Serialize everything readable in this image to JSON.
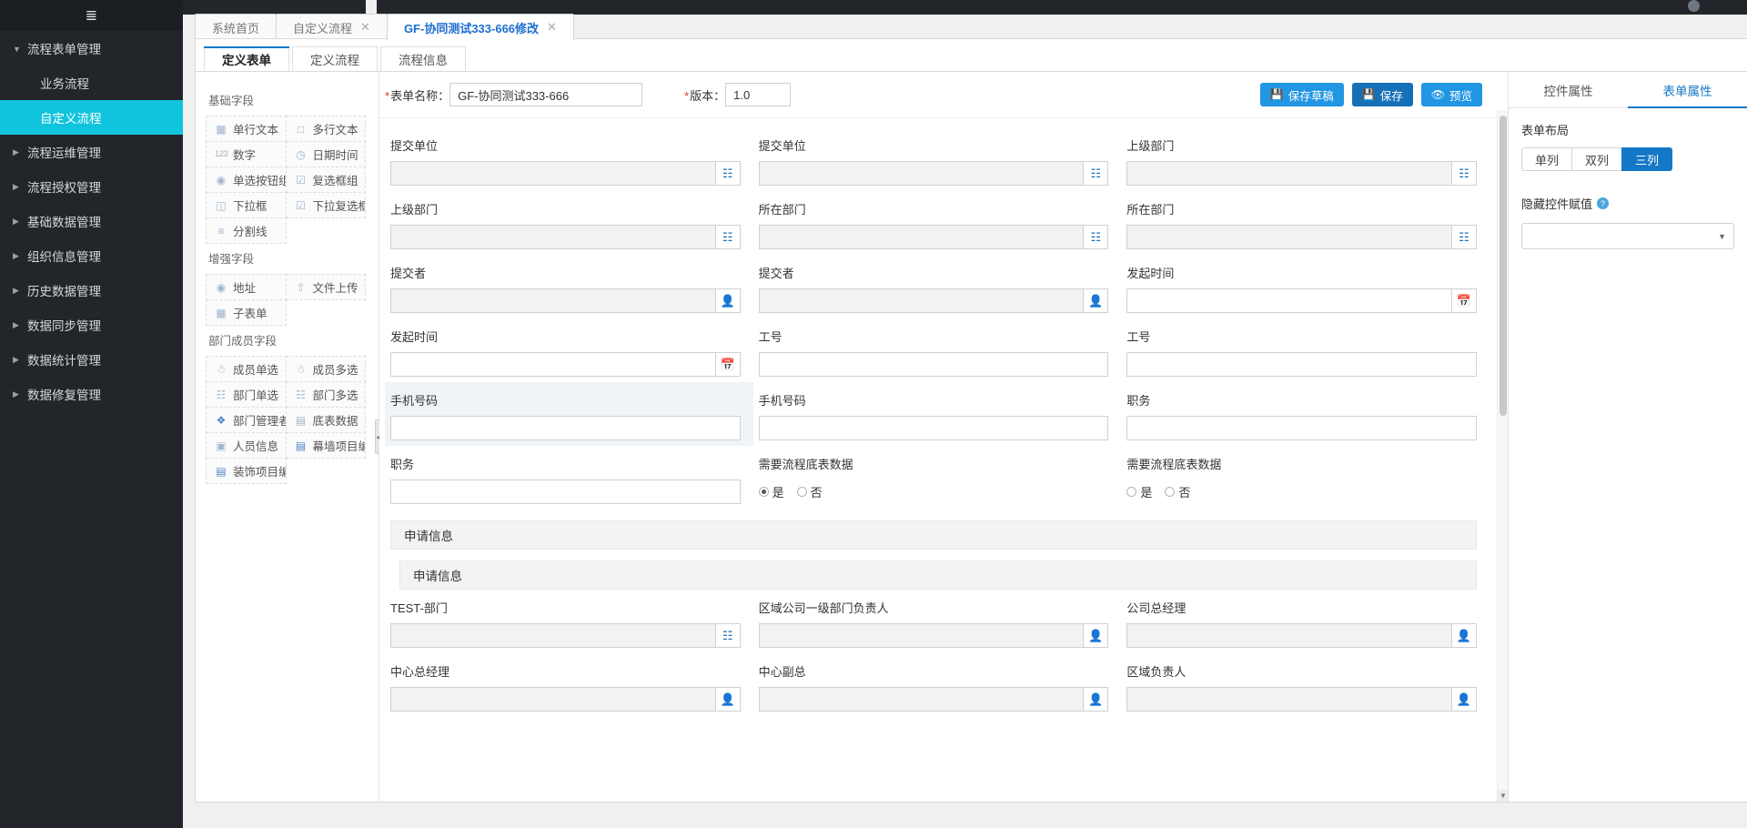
{
  "sidebar": {
    "burger_icon": "menu-icon",
    "items": [
      {
        "label": "流程表单管理",
        "type": "group",
        "expanded": true
      },
      {
        "label": "业务流程",
        "type": "sub",
        "active": false
      },
      {
        "label": "自定义流程",
        "type": "sub",
        "active": true
      },
      {
        "label": "流程运维管理",
        "type": "group",
        "expanded": false
      },
      {
        "label": "流程授权管理",
        "type": "group",
        "expanded": false
      },
      {
        "label": "基础数据管理",
        "type": "group",
        "expanded": false
      },
      {
        "label": "组织信息管理",
        "type": "group",
        "expanded": false
      },
      {
        "label": "历史数据管理",
        "type": "group",
        "expanded": false
      },
      {
        "label": "数据同步管理",
        "type": "group",
        "expanded": false
      },
      {
        "label": "数据统计管理",
        "type": "group",
        "expanded": false
      },
      {
        "label": "数据修复管理",
        "type": "group",
        "expanded": false
      }
    ]
  },
  "browser_tabs": [
    {
      "label": "系统首页",
      "closable": false,
      "active": false
    },
    {
      "label": "自定义流程",
      "closable": true,
      "active": false
    },
    {
      "label": "GF-协同测试333-666修改",
      "closable": true,
      "active": true
    }
  ],
  "inner_tabs": [
    {
      "label": "定义表单",
      "active": true
    },
    {
      "label": "定义流程",
      "active": false
    },
    {
      "label": "流程信息",
      "active": false
    }
  ],
  "palette": {
    "groups": [
      {
        "title": "基础字段",
        "items": [
          {
            "label": "单行文本",
            "icon": "single-line-text-icon"
          },
          {
            "label": "多行文本",
            "icon": "multi-line-text-icon"
          },
          {
            "label": "数字",
            "icon": "number-123-icon"
          },
          {
            "label": "日期时间",
            "icon": "date-time-icon"
          },
          {
            "label": "单选按钮组",
            "icon": "radio-group-icon"
          },
          {
            "label": "复选框组",
            "icon": "checkbox-group-icon"
          },
          {
            "label": "下拉框",
            "icon": "dropdown-icon"
          },
          {
            "label": "下拉复选框",
            "icon": "dropdown-multi-icon"
          },
          {
            "label": "分割线",
            "icon": "divider-icon"
          }
        ]
      },
      {
        "title": "增强字段",
        "items": [
          {
            "label": "地址",
            "icon": "globe-address-icon"
          },
          {
            "label": "文件上传",
            "icon": "upload-icon"
          },
          {
            "label": "子表单",
            "icon": "subform-table-icon"
          }
        ]
      },
      {
        "title": "部门成员字段",
        "items": [
          {
            "label": "成员单选",
            "icon": "user-single-icon"
          },
          {
            "label": "成员多选",
            "icon": "user-multi-icon"
          },
          {
            "label": "部门单选",
            "icon": "org-single-icon"
          },
          {
            "label": "部门多选",
            "icon": "org-multi-icon"
          },
          {
            "label": "部门管理者信",
            "icon": "shield-manager-icon"
          },
          {
            "label": "底表数据",
            "icon": "base-table-icon"
          },
          {
            "label": "人员信息",
            "icon": "person-info-icon"
          },
          {
            "label": "幕墙项目编码",
            "icon": "curtain-project-code-icon"
          },
          {
            "label": "装饰项目编码",
            "icon": "decoration-project-code-icon"
          }
        ]
      }
    ],
    "collapse_icon": "chevron-left-icon"
  },
  "form_header": {
    "name_label": "表单名称：",
    "name_value": "GF-协同测试333-666",
    "version_label": "版本：",
    "version_value": "1.0",
    "buttons": [
      {
        "label": "保存草稿",
        "icon": "save-icon",
        "style": "primary"
      },
      {
        "label": "保存",
        "icon": "save-icon",
        "style": "dark"
      },
      {
        "label": "预览",
        "icon": "eye-icon",
        "style": "preview"
      }
    ]
  },
  "canvas": {
    "rows": [
      [
        {
          "label": "提交单位",
          "control": "text-with-org-picker",
          "addon_icon": "org-tree-icon",
          "value": ""
        },
        {
          "label": "提交单位",
          "control": "text-with-org-picker",
          "addon_icon": "org-tree-icon",
          "value": ""
        },
        {
          "label": "上级部门",
          "control": "text-with-org-picker",
          "addon_icon": "org-tree-icon",
          "value": ""
        }
      ],
      [
        {
          "label": "上级部门",
          "control": "text-with-org-picker",
          "addon_icon": "org-tree-icon",
          "value": ""
        },
        {
          "label": "所在部门",
          "control": "text-with-org-picker",
          "addon_icon": "org-tree-icon",
          "value": ""
        },
        {
          "label": "所在部门",
          "control": "text-with-org-picker",
          "addon_icon": "org-tree-icon",
          "value": ""
        }
      ],
      [
        {
          "label": "提交者",
          "control": "text-with-user-picker",
          "addon_icon": "user-picker-icon",
          "value": ""
        },
        {
          "label": "提交者",
          "control": "text-with-user-picker",
          "addon_icon": "user-picker-icon",
          "value": ""
        },
        {
          "label": "发起时间",
          "control": "text-with-date-picker",
          "addon_icon": "calendar-icon",
          "value": ""
        }
      ],
      [
        {
          "label": "发起时间",
          "control": "text-with-date-picker",
          "addon_icon": "calendar-icon",
          "value": ""
        },
        {
          "label": "工号",
          "control": "text",
          "value": ""
        },
        {
          "label": "工号",
          "control": "text",
          "value": ""
        }
      ],
      [
        {
          "label": "手机号码",
          "control": "text",
          "value": "",
          "selected": true
        },
        {
          "label": "手机号码",
          "control": "text",
          "value": ""
        },
        {
          "label": "职务",
          "control": "text",
          "value": ""
        }
      ],
      [
        {
          "label": "职务",
          "control": "text",
          "value": ""
        },
        {
          "label": "需要流程底表数据",
          "control": "radio",
          "options": [
            "是",
            "否"
          ],
          "selected_option": "是"
        },
        {
          "label": "需要流程底表数据",
          "control": "radio",
          "options": [
            "是",
            "否"
          ],
          "selected_option": ""
        }
      ]
    ],
    "bands": [
      {
        "label": "申请信息",
        "indent": false
      },
      {
        "label": "申请信息",
        "indent": true
      }
    ],
    "rows_after_bands": [
      [
        {
          "label": "TEST-部门",
          "control": "text-with-org-picker",
          "addon_icon": "org-tree-icon",
          "value": ""
        },
        {
          "label": "区域公司一级部门负责人",
          "control": "text-with-user-picker",
          "addon_icon": "user-picker-icon",
          "value": ""
        },
        {
          "label": "公司总经理",
          "control": "text-with-user-picker",
          "addon_icon": "user-picker-icon",
          "value": ""
        }
      ],
      [
        {
          "label": "中心总经理",
          "control": "text-with-user-picker",
          "addon_icon": "user-picker-icon",
          "value": ""
        },
        {
          "label": "中心副总",
          "control": "text-with-user-picker",
          "addon_icon": "user-picker-icon",
          "value": ""
        },
        {
          "label": "区域负责人",
          "control": "text-with-user-picker",
          "addon_icon": "user-picker-icon",
          "value": ""
        }
      ]
    ]
  },
  "props": {
    "tabs": [
      {
        "label": "控件属性",
        "active": false
      },
      {
        "label": "表单属性",
        "active": true
      }
    ],
    "layout_label": "表单布局",
    "layout_options": [
      {
        "label": "单列",
        "active": false
      },
      {
        "label": "双列",
        "active": false
      },
      {
        "label": "三列",
        "active": true
      }
    ],
    "hidden_assign_label": "隐藏控件赋值",
    "hidden_assign_help": "?",
    "hidden_assign_value": ""
  },
  "colors": {
    "accent": "#1578c7",
    "sidebar_bg": "#22262b",
    "sidebar_active": "#11c4dd",
    "tab_active_text": "#1f6fd0",
    "selected_field_bg": "#eef4f7"
  }
}
